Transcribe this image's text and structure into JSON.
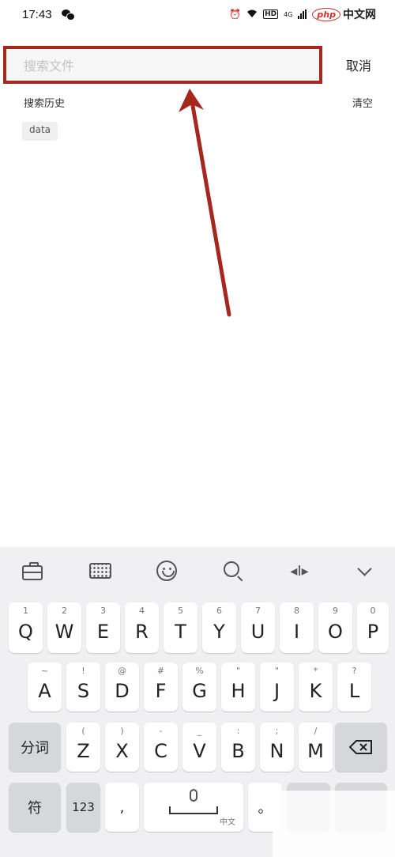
{
  "status_bar": {
    "time": "17:43",
    "hd": "HD",
    "network": "4G",
    "logo_php": "php",
    "logo_text": "中文网"
  },
  "search": {
    "placeholder": "搜索文件",
    "cancel_label": "取消"
  },
  "history": {
    "title": "搜索历史",
    "clear_label": "清空",
    "items": [
      "data"
    ]
  },
  "keyboard": {
    "toolbar": [
      "toolbox-icon",
      "keyboard-icon",
      "emoji-icon",
      "search-icon",
      "cursor-icon",
      "collapse-icon"
    ],
    "row1": [
      {
        "main": "Q",
        "sub": "1"
      },
      {
        "main": "W",
        "sub": "2"
      },
      {
        "main": "E",
        "sub": "3"
      },
      {
        "main": "R",
        "sub": "4"
      },
      {
        "main": "T",
        "sub": "5"
      },
      {
        "main": "Y",
        "sub": "6"
      },
      {
        "main": "U",
        "sub": "7"
      },
      {
        "main": "I",
        "sub": "8"
      },
      {
        "main": "O",
        "sub": "9"
      },
      {
        "main": "P",
        "sub": "0"
      }
    ],
    "row2": [
      {
        "main": "A",
        "sub": "~"
      },
      {
        "main": "S",
        "sub": "!"
      },
      {
        "main": "D",
        "sub": "@"
      },
      {
        "main": "F",
        "sub": "#"
      },
      {
        "main": "G",
        "sub": "%"
      },
      {
        "main": "H",
        "sub": "\""
      },
      {
        "main": "J",
        "sub": "\""
      },
      {
        "main": "K",
        "sub": "*"
      },
      {
        "main": "L",
        "sub": "?"
      }
    ],
    "row3": [
      {
        "main": "Z",
        "sub": "("
      },
      {
        "main": "X",
        "sub": ")"
      },
      {
        "main": "C",
        "sub": "-"
      },
      {
        "main": "V",
        "sub": "_"
      },
      {
        "main": "B",
        "sub": ":"
      },
      {
        "main": "N",
        "sub": ";"
      },
      {
        "main": "M",
        "sub": "/"
      }
    ],
    "segment_label": "分词",
    "symbol_label": "符",
    "number_label": "123",
    "comma_label": ",",
    "period_label": "。",
    "space_sub": "中文"
  }
}
